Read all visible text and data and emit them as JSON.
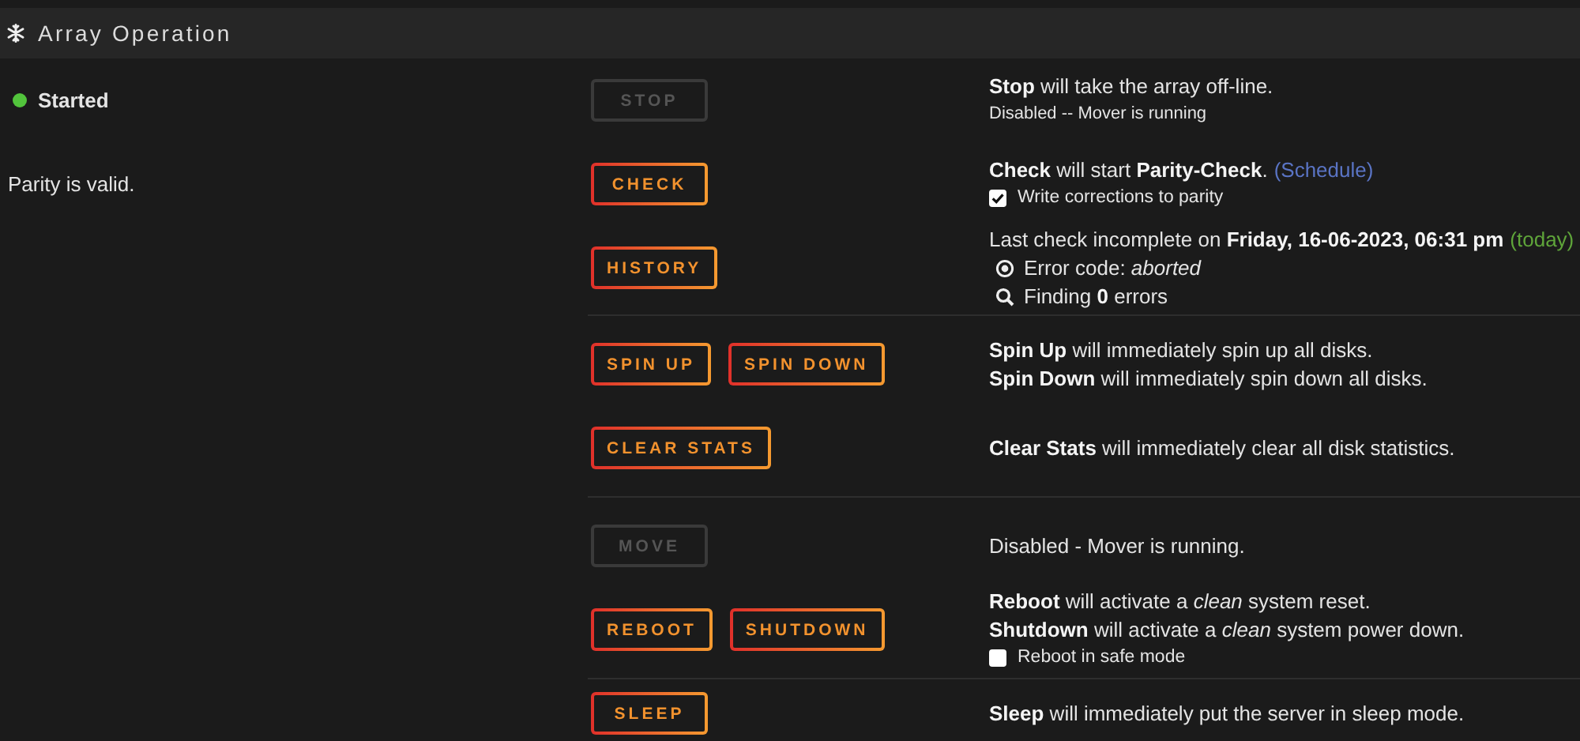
{
  "panel": {
    "title": "Array Operation"
  },
  "sections": [
    {
      "rows": [
        {
          "left": {
            "kind": "status",
            "label": "Started",
            "on": true
          },
          "buttons": [
            {
              "label": "STOP",
              "disabled": true
            }
          ],
          "lines": [
            {
              "kind": "text",
              "text": "**Stop** will take the array off-line."
            },
            {
              "kind": "note",
              "text": "Disabled -- Mover is running"
            }
          ]
        },
        {
          "left": {
            "kind": "text",
            "label": "Parity is valid."
          },
          "buttons": [
            {
              "label": "CHECK",
              "disabled": false
            }
          ],
          "lines": [
            {
              "kind": "text",
              "text": "**Check** will start **Parity-Check**.",
              "link": "(Schedule)"
            },
            {
              "kind": "checkbox",
              "text": "Write corrections to parity",
              "checked": true
            }
          ]
        },
        {
          "buttons": [
            {
              "label": "HISTORY",
              "disabled": false
            }
          ],
          "lines": [
            {
              "kind": "text",
              "text": "Last check incomplete on **Friday, 16-06-2023, 06:31 pm**",
              "tag": "(today)"
            },
            {
              "kind": "radio-line",
              "text": "Error code: *aborted*"
            },
            {
              "kind": "search-line",
              "text": "Finding **0** errors"
            }
          ]
        }
      ]
    },
    {
      "rows": [
        {
          "buttons": [
            {
              "label": "SPIN UP",
              "disabled": false
            },
            {
              "label": "SPIN DOWN",
              "disabled": false
            }
          ],
          "lines": [
            {
              "kind": "text",
              "text": "**Spin Up** will immediately spin up all disks."
            },
            {
              "kind": "text",
              "text": "**Spin Down** will immediately spin down all disks."
            }
          ]
        },
        {
          "buttons": [
            {
              "label": "CLEAR STATS",
              "disabled": false
            }
          ],
          "lines": [
            {
              "kind": "text",
              "text": "**Clear Stats** will immediately clear all disk statistics."
            }
          ]
        }
      ]
    },
    {
      "rows": [
        {
          "buttons": [
            {
              "label": "MOVE",
              "disabled": true
            }
          ],
          "lines": [
            {
              "kind": "text",
              "text": "Disabled - Mover is running."
            }
          ]
        },
        {
          "buttons": [
            {
              "label": "REBOOT",
              "disabled": false
            },
            {
              "label": "SHUTDOWN",
              "disabled": false
            }
          ],
          "lines": [
            {
              "kind": "text",
              "text": "**Reboot** will activate a *clean* system reset."
            },
            {
              "kind": "text",
              "text": "**Shutdown** will activate a *clean* system power down."
            },
            {
              "kind": "checkbox",
              "text": "Reboot in safe mode",
              "checked": false
            }
          ]
        }
      ]
    },
    {
      "rows": [
        {
          "buttons": [
            {
              "label": "SLEEP",
              "disabled": false
            }
          ],
          "lines": [
            {
              "kind": "text",
              "text": "**Sleep** will immediately put the server in sleep mode."
            }
          ]
        }
      ]
    }
  ]
}
